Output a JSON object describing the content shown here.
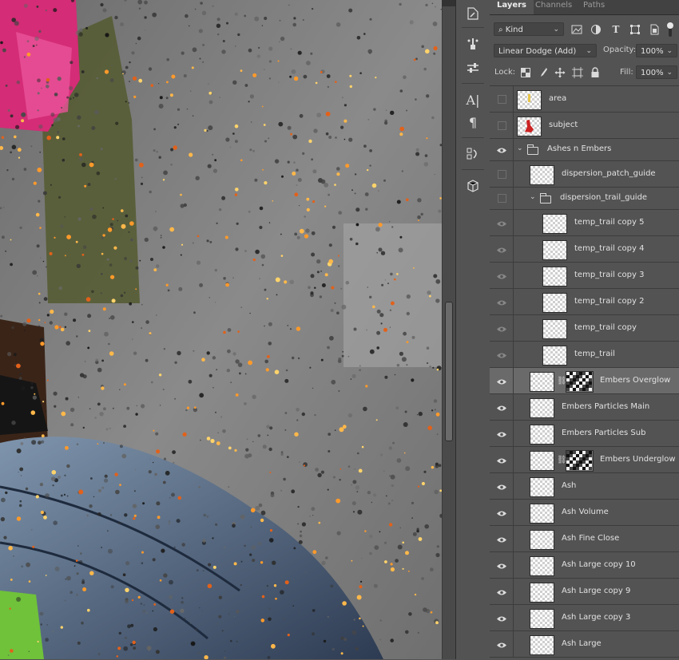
{
  "panel": {
    "tabs": [
      {
        "label": "Layers"
      },
      {
        "label": "Channels"
      },
      {
        "label": "Paths"
      }
    ],
    "filter": {
      "kind_label": "Kind"
    },
    "blend_mode": "Linear Dodge (Add)",
    "opacity": {
      "label": "Opacity:",
      "value": "100%"
    },
    "lock": {
      "label": "Lock:"
    },
    "fill": {
      "label": "Fill:",
      "value": "100%"
    }
  },
  "layers": [
    {
      "name": "area",
      "visible": false,
      "indent": 0,
      "type": "layer",
      "thumb": "area-swatch"
    },
    {
      "name": "subject",
      "visible": false,
      "indent": 0,
      "type": "layer",
      "thumb": "subject-swatch"
    },
    {
      "name": "Ashes n Embers",
      "visible": true,
      "indent": 0,
      "type": "group"
    },
    {
      "name": "dispersion_patch_guide",
      "visible": false,
      "indent": 1,
      "type": "layer"
    },
    {
      "name": "dispersion_trail_guide",
      "visible": false,
      "indent": 1,
      "type": "group"
    },
    {
      "name": "temp_trail copy 5",
      "visible": true,
      "dim": true,
      "indent": 2,
      "type": "layer"
    },
    {
      "name": "temp_trail copy 4",
      "visible": true,
      "dim": true,
      "indent": 2,
      "type": "layer"
    },
    {
      "name": "temp_trail copy 3",
      "visible": true,
      "dim": true,
      "indent": 2,
      "type": "layer"
    },
    {
      "name": "temp_trail copy 2",
      "visible": true,
      "dim": true,
      "indent": 2,
      "type": "layer"
    },
    {
      "name": "temp_trail copy",
      "visible": true,
      "dim": true,
      "indent": 2,
      "type": "layer"
    },
    {
      "name": "temp_trail",
      "visible": true,
      "dim": true,
      "indent": 2,
      "type": "layer"
    },
    {
      "name": "Embers Overglow",
      "visible": true,
      "indent": 1,
      "type": "layer",
      "mask": true,
      "selected": true
    },
    {
      "name": "Embers Particles Main",
      "visible": true,
      "indent": 1,
      "type": "layer"
    },
    {
      "name": "Embers Particles Sub",
      "visible": true,
      "indent": 1,
      "type": "layer"
    },
    {
      "name": "Embers Underglow",
      "visible": true,
      "indent": 1,
      "type": "layer",
      "mask": true
    },
    {
      "name": "Ash",
      "visible": true,
      "indent": 1,
      "type": "layer"
    },
    {
      "name": "Ash Volume",
      "visible": true,
      "indent": 1,
      "type": "layer"
    },
    {
      "name": "Ash Fine Close",
      "visible": true,
      "indent": 1,
      "type": "layer"
    },
    {
      "name": "Ash Large copy 10",
      "visible": true,
      "indent": 1,
      "type": "layer"
    },
    {
      "name": "Ash Large copy 9",
      "visible": true,
      "indent": 1,
      "type": "layer"
    },
    {
      "name": "Ash Large copy 3",
      "visible": true,
      "indent": 1,
      "type": "layer"
    },
    {
      "name": "Ash Large",
      "visible": true,
      "indent": 1,
      "type": "layer"
    }
  ],
  "toolstrip": [
    {
      "icon": "history-brush-icon"
    },
    {
      "icon": "brush-presets-icon"
    },
    {
      "icon": "adjustments-sliders-icon"
    },
    {
      "icon": "character-icon"
    },
    {
      "icon": "paragraph-icon"
    },
    {
      "icon": "timeline-icon"
    },
    {
      "icon": "3d-cube-icon"
    }
  ],
  "colors": {
    "panel_bg": "#535353",
    "selected_row": "#6a6a6a",
    "tab_bar": "#424242",
    "text": "#e2e2e2"
  }
}
